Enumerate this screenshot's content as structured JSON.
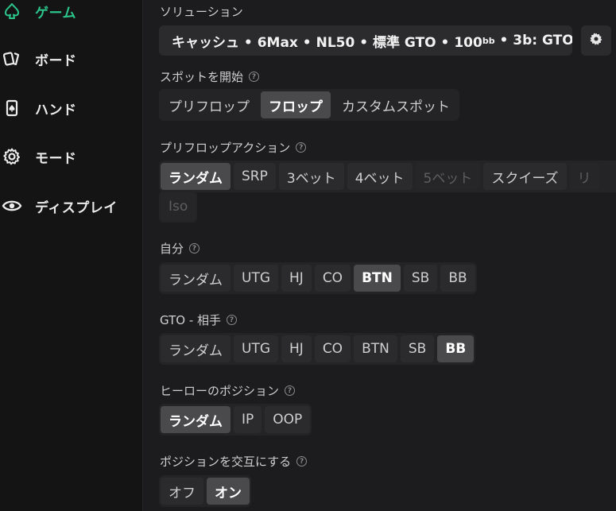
{
  "sidebar": {
    "items": [
      {
        "label": "ゲーム",
        "icon": "spade-icon",
        "active": true
      },
      {
        "label": "ボード",
        "icon": "cards-icon"
      },
      {
        "label": "ハンド",
        "icon": "card-icon"
      },
      {
        "label": "モード",
        "icon": "gear-icon"
      },
      {
        "label": "ディスプレイ",
        "icon": "eye-icon"
      }
    ]
  },
  "solution": {
    "label": "ソリューション",
    "value_main": "キャッシュ • 6Max • NL50 • 標準 GTO • 100",
    "value_sub": "bb",
    "value_tail": " • 3b: GTO"
  },
  "spot_start": {
    "label": "スポットを開始",
    "options": [
      "プリフロップ",
      "フロップ",
      "カスタムスポット"
    ],
    "selected": "フロップ"
  },
  "preflop_action": {
    "label": "プリフロップアクション",
    "options": [
      "ランダム",
      "SRP",
      "3ベット",
      "4ベット",
      "5ベット",
      "スクイーズ",
      "リ",
      "Iso"
    ],
    "selected": "ランダム",
    "disabled": [
      "5ベット",
      "リ",
      "Iso"
    ]
  },
  "self": {
    "label": "自分",
    "options": [
      "ランダム",
      "UTG",
      "HJ",
      "CO",
      "BTN",
      "SB",
      "BB"
    ],
    "selected": "BTN"
  },
  "opponent": {
    "label": "GTO - 相手",
    "options": [
      "ランダム",
      "UTG",
      "HJ",
      "CO",
      "BTN",
      "SB",
      "BB"
    ],
    "selected": "BB"
  },
  "hero_position": {
    "label": "ヒーローのポジション",
    "options": [
      "ランダム",
      "IP",
      "OOP"
    ],
    "selected": "ランダム"
  },
  "alternate_position": {
    "label": "ポジションを交互にする",
    "options": [
      "オフ",
      "オン"
    ],
    "selected": "オン"
  },
  "help_glyph": "?"
}
